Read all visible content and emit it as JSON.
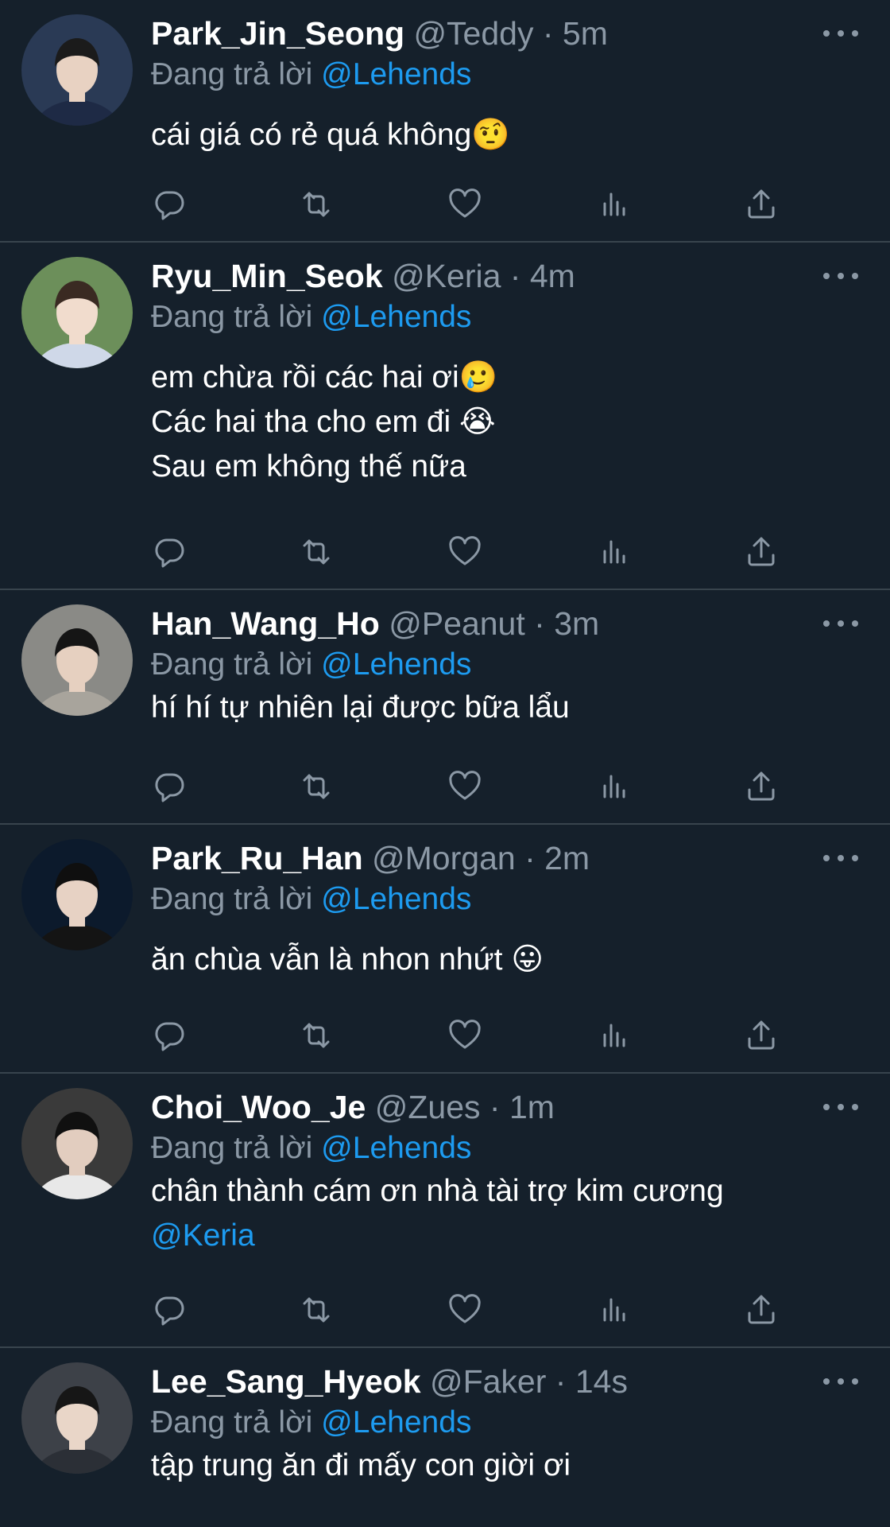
{
  "tweets": [
    {
      "name": "Park_Jin_Seong",
      "handle": "@Teddy",
      "time": "5m",
      "replying_prefix": "Đang trả lời",
      "replying_to": "@Lehends",
      "text": "cái giá có rẻ quá không🤨",
      "mention_tail": "",
      "avatar_colors": {
        "bg": "#2a3a55",
        "skin": "#e8d2c2",
        "hair": "#1b1b1b",
        "shirt": "#1e2a45"
      }
    },
    {
      "name": "Ryu_Min_Seok",
      "handle": "@Keria",
      "time": "4m",
      "replying_prefix": "Đang trả lời",
      "replying_to": "@Lehends",
      "text": "em chừa rồi các hai ơi🥲\nCác hai tha cho em đi 😭\nSau em không thế nữa",
      "mention_tail": "",
      "avatar_colors": {
        "bg": "#6c8f5a",
        "skin": "#f1dccd",
        "hair": "#3a2a22",
        "shirt": "#cfd8e8"
      }
    },
    {
      "name": "Han_Wang_Ho",
      "handle": "@Peanut",
      "time": "3m",
      "replying_prefix": "Đang trả lời",
      "replying_to": "@Lehends",
      "text": "hí hí tự nhiên lại được bữa lẩu",
      "mention_tail": "",
      "avatar_colors": {
        "bg": "#8a8a86",
        "skin": "#e6d0c0",
        "hair": "#151515",
        "shirt": "#a8a49c"
      }
    },
    {
      "name": "Park_Ru_Han",
      "handle": "@Morgan",
      "time": "2m",
      "replying_prefix": "Đang trả lời",
      "replying_to": "@Lehends",
      "text": "ăn chùa vẫn là nhon nhứt 😛",
      "mention_tail": "",
      "avatar_colors": {
        "bg": "#0c1a2c",
        "skin": "#e7d2c4",
        "hair": "#0f0f0f",
        "shirt": "#141414"
      }
    },
    {
      "name": "Choi_Woo_Je",
      "handle": "@Zues",
      "time": "1m",
      "replying_prefix": "Đang trả lời",
      "replying_to": "@Lehends",
      "text": "chân thành cám ơn nhà tài trợ kim cương",
      "mention_tail": "@Keria",
      "avatar_colors": {
        "bg": "#3a3a3a",
        "skin": "#e2cdbf",
        "hair": "#101010",
        "shirt": "#e8e8e8"
      }
    },
    {
      "name": "Lee_Sang_Hyeok",
      "handle": "@Faker",
      "time": "14s",
      "replying_prefix": "Đang trả lời",
      "replying_to": "@Lehends",
      "text": "tập trung ăn đi mấy con giời ơi",
      "mention_tail": "",
      "avatar_colors": {
        "bg": "#3d4148",
        "skin": "#e9d6c8",
        "hair": "#161616",
        "shirt": "#2b2f36"
      }
    }
  ],
  "action_icons": [
    "reply-icon",
    "retweet-icon",
    "like-icon",
    "analytics-icon",
    "share-icon"
  ],
  "colors": {
    "background": "#15202b",
    "divider": "#38444d",
    "secondary_text": "#8b98a5",
    "mention": "#1d9bf0"
  }
}
